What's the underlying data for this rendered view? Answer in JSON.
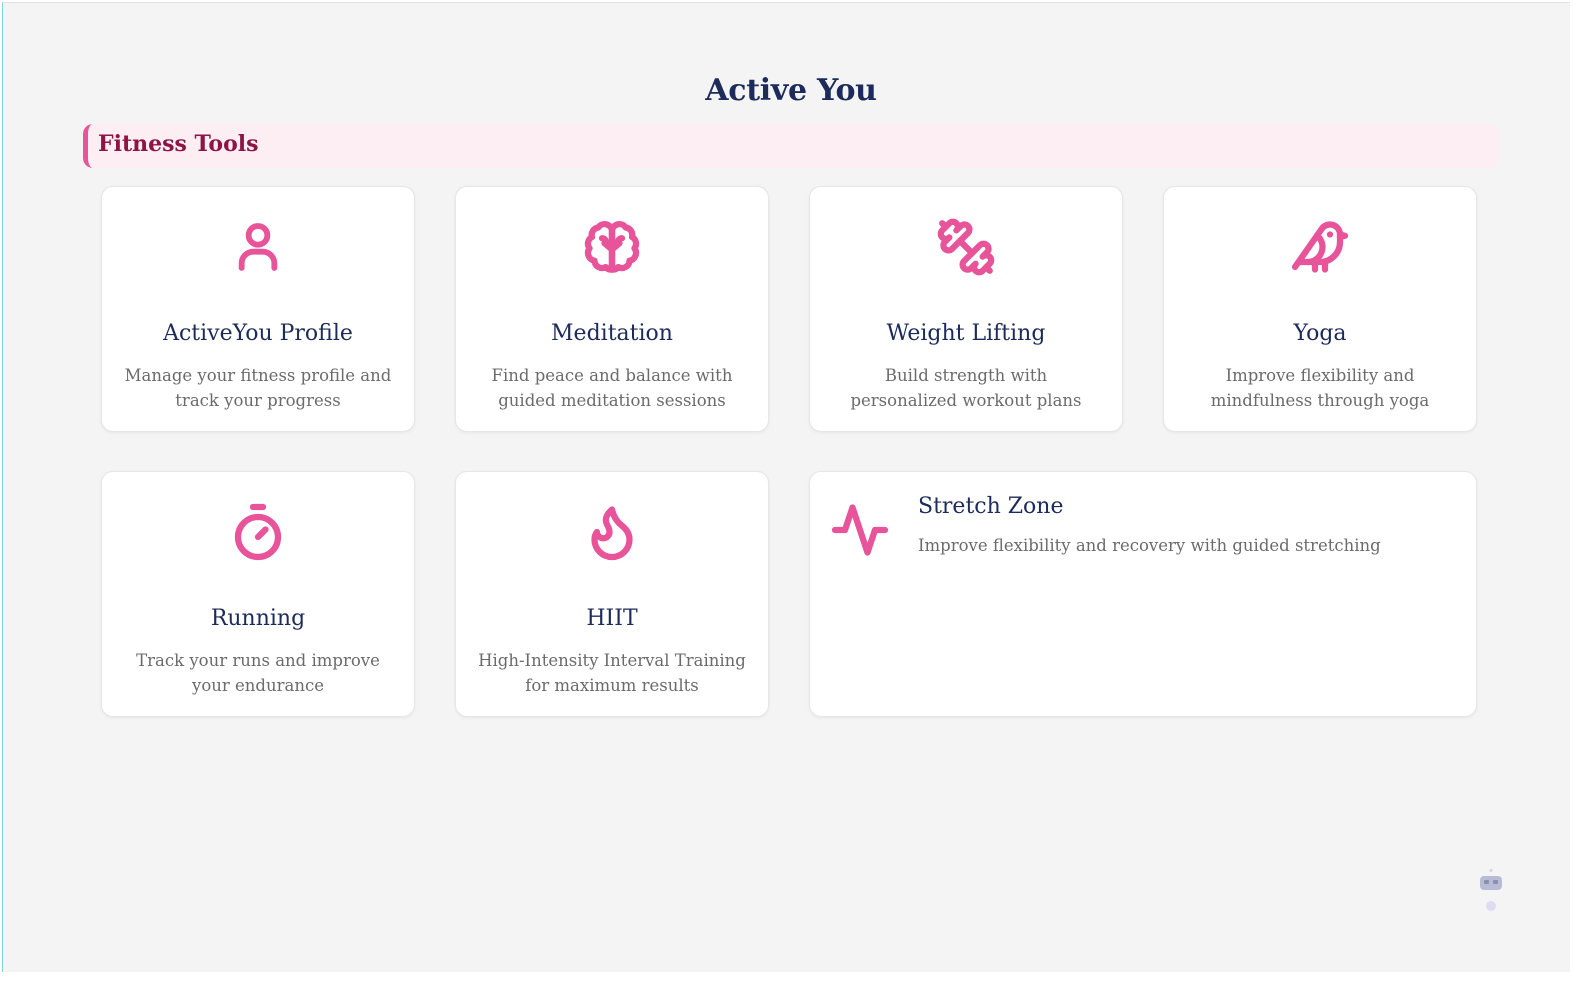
{
  "page": {
    "title": "Active You",
    "section_title": "Fitness Tools"
  },
  "cards": [
    {
      "title": "ActiveYou Profile",
      "description": "Manage your fitness profile and track your progress",
      "icon": "user-icon"
    },
    {
      "title": "Meditation",
      "description": "Find peace and balance with guided meditation sessions",
      "icon": "brain-icon"
    },
    {
      "title": "Weight Lifting",
      "description": "Build strength with personalized workout plans",
      "icon": "dumbbell-icon"
    },
    {
      "title": "Yoga",
      "description": "Improve flexibility and mindfulness through yoga",
      "icon": "bird-icon"
    },
    {
      "title": "Running",
      "description": "Track your runs and improve your endurance",
      "icon": "stopwatch-icon"
    },
    {
      "title": "HIIT",
      "description": "High-Intensity Interval Training for maximum results",
      "icon": "flame-icon"
    },
    {
      "title": "Stretch Zone",
      "description": "Improve flexibility and recovery with guided stretching",
      "icon": "activity-icon"
    }
  ],
  "colors": {
    "accent": "#e7549a",
    "heading": "#1c2b5a",
    "section_text": "#8e1446",
    "section_bg": "#fdeef4",
    "page_bg": "#f4f4f4"
  },
  "assistant_widget": {
    "icon": "robot-icon"
  }
}
